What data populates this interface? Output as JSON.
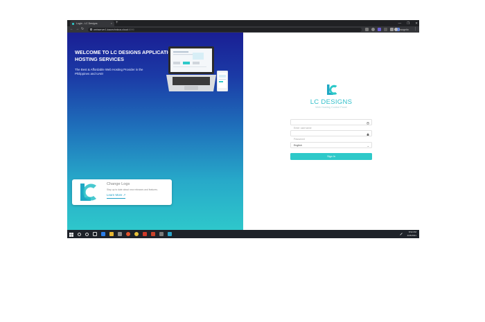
{
  "browser": {
    "tab_title": "Login - LC Designs",
    "tab_close": "×",
    "new_tab": "+",
    "address_host": "webserver1.lcacechnlcus.cloud",
    "address_port": ":8090",
    "profile_name": "Incognito",
    "window_controls": [
      "—",
      "❐",
      "✕"
    ],
    "menu": "⋮"
  },
  "hero": {
    "title": "WELCOME TO LC DESIGNS APPLICATION HOSTING SERVICES",
    "subtitle": "The Best & Affordable Web Hosting Provider in the Philippines and UAE!"
  },
  "changelog": {
    "title": "Change Logs",
    "description": "Stay up to date about new releases and features.",
    "link": "Learn More"
  },
  "login": {
    "brand_name": "LC DESIGNS",
    "brand_tagline": "Web Hosting Control Panel",
    "username_placeholder": "Enter username",
    "password_placeholder": "Password",
    "language": "English",
    "submit": "Sign In"
  },
  "taskbar": {
    "time": "8:52 PM",
    "date": "4/26/2021"
  },
  "colors": {
    "accent": "#2EC9C9",
    "hero_top": "#1A1F94",
    "hero_bottom": "#2EC7CB",
    "taskbar": "#1E2229"
  },
  "icons": [
    "user-icon",
    "lock-icon",
    "chevron-down-icon",
    "external-link-icon",
    "windows-start-icon",
    "search-icon",
    "back-icon",
    "forward-icon",
    "reload-icon"
  ]
}
